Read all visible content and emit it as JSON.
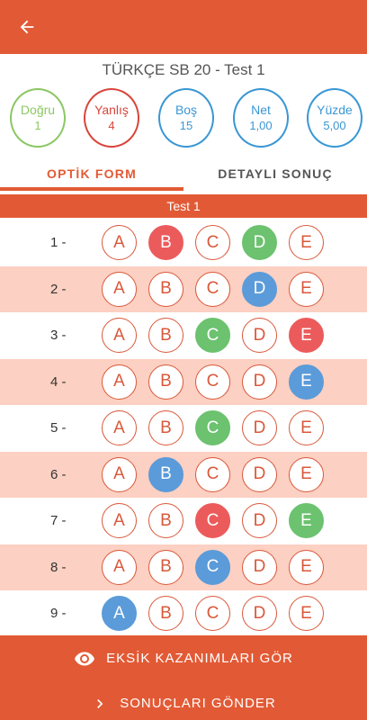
{
  "header": {
    "title": "TÜRKÇE SB 20  - Test 1"
  },
  "stats": [
    {
      "label": "Doğru",
      "value": "1",
      "color": "#8cc764"
    },
    {
      "label": "Yanlış",
      "value": "4",
      "color": "#d9453a"
    },
    {
      "label": "Boş",
      "value": "15",
      "color": "#3a97d4"
    },
    {
      "label": "Net",
      "value": "1,00",
      "color": "#3a97d4"
    },
    {
      "label": "Yüzde",
      "value": "5,00",
      "color": "#3a97d4"
    }
  ],
  "tabs": [
    {
      "label": "OPTİK FORM",
      "active": true
    },
    {
      "label": "DETAYLI SONUÇ",
      "active": false
    }
  ],
  "section": {
    "title": "Test 1"
  },
  "options": [
    "A",
    "B",
    "C",
    "D",
    "E"
  ],
  "questions": [
    {
      "num": "1 -",
      "marks": {
        "B": "red",
        "D": "green"
      }
    },
    {
      "num": "2 -",
      "marks": {
        "D": "blue"
      }
    },
    {
      "num": "3 -",
      "marks": {
        "C": "green",
        "E": "red"
      }
    },
    {
      "num": "4 -",
      "marks": {
        "E": "blue"
      }
    },
    {
      "num": "5 -",
      "marks": {
        "C": "green"
      }
    },
    {
      "num": "6 -",
      "marks": {
        "B": "blue"
      }
    },
    {
      "num": "7 -",
      "marks": {
        "C": "red",
        "E": "green"
      }
    },
    {
      "num": "8 -",
      "marks": {
        "C": "blue"
      }
    },
    {
      "num": "9 -",
      "marks": {
        "A": "blue"
      }
    }
  ],
  "footer": {
    "missing_label": "EKSİK KAZANIMLARI GÖR",
    "missing_icon": "eye-icon",
    "send_label": "SONUÇLARI GÖNDER",
    "send_icon": "chevron-right-icon"
  },
  "colors": {
    "accent": "#e25a35",
    "alt_row": "#fcd0c2"
  }
}
